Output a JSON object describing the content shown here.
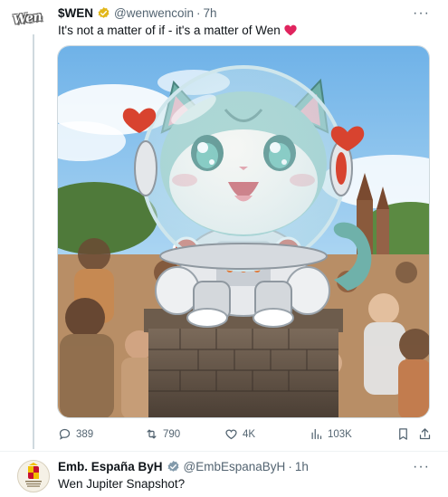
{
  "tweet": {
    "avatar_text": "Wen",
    "display_name": "$WEN",
    "handle": "@wenwencoin",
    "separator": "·",
    "time": "7h",
    "more_label": "···",
    "text": "It's not a matter of if - it's a matter of Wen",
    "media_alt": "Chibi astronaut cat with a glass helmet sitting on a brick pedestal in front of a crowd",
    "actions": {
      "replies": "389",
      "retweets": "790",
      "likes": "4K",
      "views": "103K"
    }
  },
  "reply": {
    "display_name": "Emb. España ByH",
    "handle": "@EmbEspanaByH",
    "separator": "·",
    "time": "1h",
    "more_label": "···",
    "text": "Wen Jupiter Snapshot?"
  },
  "colors": {
    "verified_gold": "#e2b719",
    "verified_gray": "#829aab",
    "text_secondary": "#536471",
    "heart_red": "#e0245e"
  },
  "icons": [
    "verified-badge-icon",
    "heart-emoji-icon",
    "reply-icon",
    "retweet-icon",
    "like-icon",
    "views-icon",
    "bookmark-icon",
    "share-icon",
    "more-icon"
  ]
}
